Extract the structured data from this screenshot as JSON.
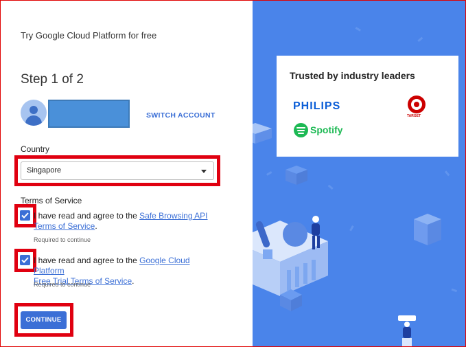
{
  "header": {
    "title": "Try Google Cloud Platform for free"
  },
  "step": {
    "label": "Step 1 of 2"
  },
  "account": {
    "switch_label": "SWITCH ACCOUNT"
  },
  "country": {
    "label": "Country",
    "selected": "Singapore"
  },
  "terms": {
    "label": "Terms of Service",
    "items": [
      {
        "checked": true,
        "prefix": "I have read and agree to the ",
        "link_line1": "Safe Browsing API",
        "link_line2": "Terms of Service",
        "suffix": ".",
        "required": "Required to continue"
      },
      {
        "checked": true,
        "prefix": "I have read and agree to the ",
        "link_line1": "Google Cloud Platform",
        "link_line2": "Free Trial Terms of Service",
        "suffix": ".",
        "required": "Required to continue"
      }
    ]
  },
  "continue_label": "CONTINUE",
  "sidebar": {
    "card_title": "Trusted by industry leaders",
    "logos": {
      "philips": "PHILIPS",
      "spotify": "Spotify",
      "target": "TARGET"
    }
  },
  "colors": {
    "accent": "#3b6fd6",
    "panel_bg": "#4a84ea",
    "highlight": "#e00010"
  },
  "icons": [
    "avatar-icon",
    "chevron-down-icon",
    "checkmark-icon",
    "spotify-logo-icon",
    "target-logo-icon"
  ]
}
